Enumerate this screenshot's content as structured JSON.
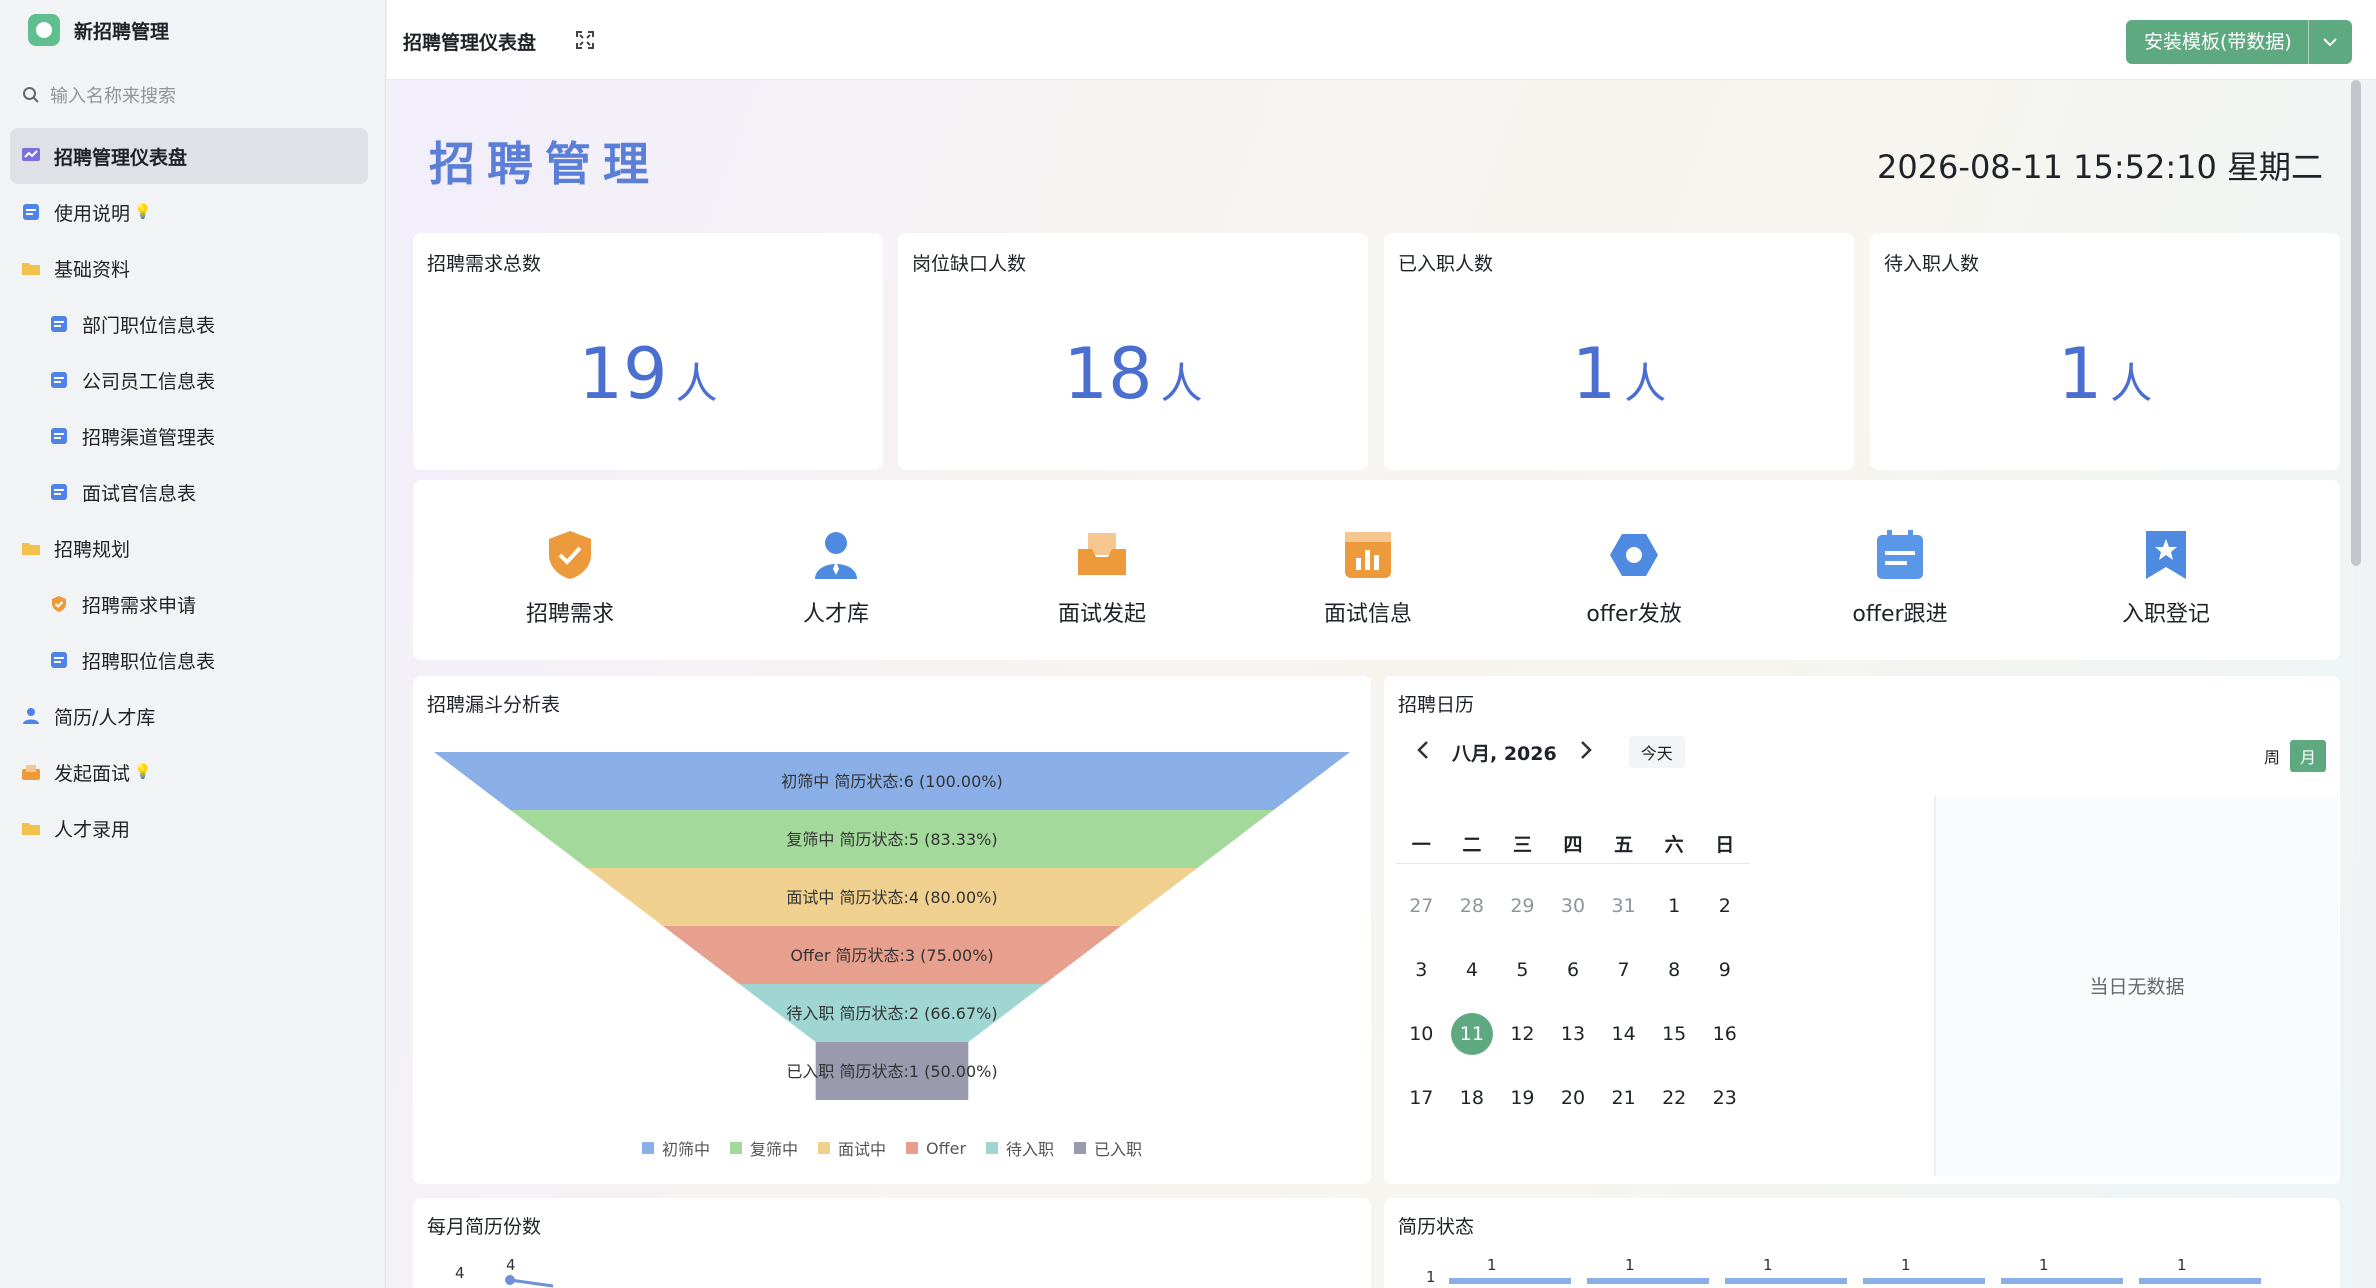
{
  "sidebar": {
    "app_title": "新招聘管理",
    "search_placeholder": "输入名称来搜索",
    "items": [
      {
        "label": "招聘管理仪表盘",
        "icon": "dashboard-icon"
      },
      {
        "label": "使用说明",
        "icon": "doc-icon"
      },
      {
        "label": "基础资料",
        "icon": "folder-icon"
      },
      {
        "label": "部门职位信息表",
        "icon": "table-icon"
      },
      {
        "label": "公司员工信息表",
        "icon": "table-icon"
      },
      {
        "label": "招聘渠道管理表",
        "icon": "table-icon"
      },
      {
        "label": "面试官信息表",
        "icon": "table-icon"
      },
      {
        "label": "招聘规划",
        "icon": "folder-icon"
      },
      {
        "label": "招聘需求申请",
        "icon": "shield-icon"
      },
      {
        "label": "招聘职位信息表",
        "icon": "table-icon"
      },
      {
        "label": "简历/人才库",
        "icon": "person-icon"
      },
      {
        "label": "发起面试",
        "icon": "box-icon"
      },
      {
        "label": "人才录用",
        "icon": "folder-icon"
      }
    ]
  },
  "header": {
    "title": "招聘管理仪表盘",
    "install_label": "安装模板(带数据)"
  },
  "dashboard": {
    "title": "招聘管理",
    "datetime": "2026-08-11 15:52:10 星期二",
    "stats": [
      {
        "label": "招聘需求总数",
        "value": "19",
        "unit": "人"
      },
      {
        "label": "岗位缺口人数",
        "value": "18",
        "unit": "人"
      },
      {
        "label": "已入职人数",
        "value": "1",
        "unit": "人"
      },
      {
        "label": "待入职人数",
        "value": "1",
        "unit": "人"
      }
    ],
    "quick_links": [
      {
        "label": "招聘需求",
        "icon": "shield-check-icon"
      },
      {
        "label": "人才库",
        "icon": "person-icon"
      },
      {
        "label": "面试发起",
        "icon": "inbox-icon"
      },
      {
        "label": "面试信息",
        "icon": "bar-chart-icon"
      },
      {
        "label": "offer发放",
        "icon": "hexagon-icon"
      },
      {
        "label": "offer跟进",
        "icon": "calendar-list-icon"
      },
      {
        "label": "入职登记",
        "icon": "bookmark-star-icon"
      }
    ]
  },
  "funnel": {
    "title": "招聘漏斗分析表",
    "colors": [
      "#8aaee6",
      "#a4d99c",
      "#f0d08e",
      "#e8a08e",
      "#9fd6d2",
      "#9a9aae"
    ]
  },
  "chart_data": {
    "type": "funnel",
    "categories": [
      "初筛中",
      "复筛中",
      "面试中",
      "Offer",
      "待入职",
      "已入职"
    ],
    "values": [
      6,
      5,
      4,
      3,
      2,
      1
    ],
    "labels": [
      "初筛中 简历状态:6 (100.00%)",
      "复筛中 简历状态:5 (83.33%)",
      "面试中 简历状态:4 (80.00%)",
      "Offer 简历状态:3 (75.00%)",
      "待入职 简历状态:2 (66.67%)",
      "已入职 简历状态:1 (50.00%)"
    ]
  },
  "calendar": {
    "title": "招聘日历",
    "month_label": "八月, 2026",
    "today_label": "今天",
    "view_week": "周",
    "view_month": "月",
    "weekdays": [
      "一",
      "二",
      "三",
      "四",
      "五",
      "六",
      "日"
    ],
    "weeks": [
      [
        "27",
        "28",
        "29",
        "30",
        "31",
        "1",
        "2"
      ],
      [
        "3",
        "4",
        "5",
        "6",
        "7",
        "8",
        "9"
      ],
      [
        "10",
        "11",
        "12",
        "13",
        "14",
        "15",
        "16"
      ],
      [
        "17",
        "18",
        "19",
        "20",
        "21",
        "22",
        "23"
      ]
    ],
    "selected": "11",
    "no_data": "当日无数据"
  },
  "monthly_resume": {
    "title": "每月简历份数",
    "tick": "4",
    "point_label": "4"
  },
  "resume_status": {
    "title": "简历状态",
    "tick": "1",
    "bar_labels": [
      "1",
      "1",
      "1",
      "1",
      "1",
      "1"
    ]
  }
}
